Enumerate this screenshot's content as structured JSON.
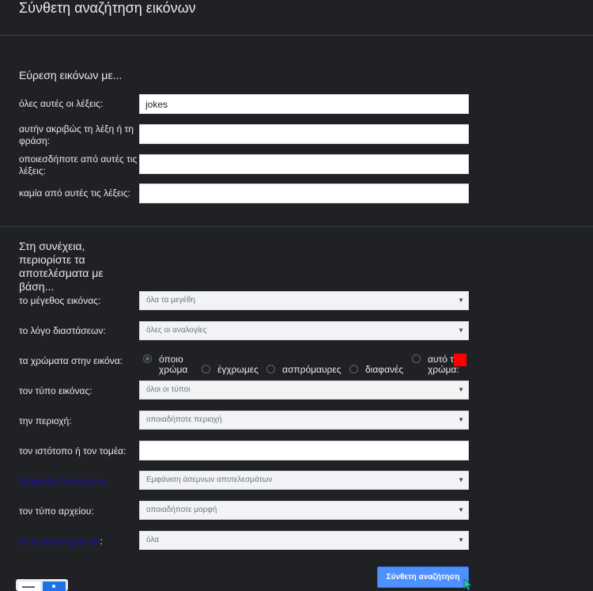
{
  "header": {
    "title": "Σύνθετη αναζήτηση εικόνων"
  },
  "find": {
    "heading": "Εύρεση εικόνων με...",
    "all_words": {
      "label": "όλες αυτές οι λέξεις:",
      "value": "jokes"
    },
    "exact_phrase": {
      "label": "αυτήν ακριβώς τη λέξη ή τη φράση:",
      "value": ""
    },
    "any_words": {
      "label": "οποιεσδήποτε από αυτές τις λέξεις:",
      "value": ""
    },
    "none_words": {
      "label": "καμία από αυτές τις λέξεις:",
      "value": ""
    }
  },
  "narrow": {
    "heading": "Στη συνέχεια, περιορίστε τα αποτελέσματα με βάση...",
    "size": {
      "label": "το μέγεθος εικόνας:",
      "value": "όλα τα μεγέθη"
    },
    "aspect": {
      "label": "το λόγο διαστάσεων:",
      "value": "όλες οι αναλογίες"
    },
    "colors": {
      "label": "τα χρώματα στην εικόνα:",
      "options": [
        "όποιο χρώμα",
        "έγχρωμες",
        "ασπρόμαυρες",
        "διαφανές",
        "αυτό το χρώμα:"
      ],
      "selected": "όποιο χρώμα",
      "swatch_color": "#ff0000"
    },
    "type": {
      "label": "τον τύπο εικόνας:",
      "value": "όλοι οι τύποι"
    },
    "region": {
      "label": "την περιοχή:",
      "value": "οποιαδήποτε περιοχή"
    },
    "site": {
      "label": "τον ιστότοπο ή τον τομέα:",
      "value": ""
    },
    "safesearch": {
      "label_link": "Ασφαλής Αναζήτηση",
      "value": "Εμφάνιση άσεμνων αποτελεσμάτων"
    },
    "filetype": {
      "label": "τον τύπο αρχείου:",
      "value": "οποιαδήποτε μορφή"
    },
    "rights": {
      "label_link": "δικαιώματα χρήσης",
      "suffix": ":",
      "value": "όλα"
    }
  },
  "submit_label": "Σύνθετη αναζήτηση",
  "colors": {
    "background": "#202124",
    "accent_button": "#4d90fe",
    "link": "#1a0dab"
  }
}
